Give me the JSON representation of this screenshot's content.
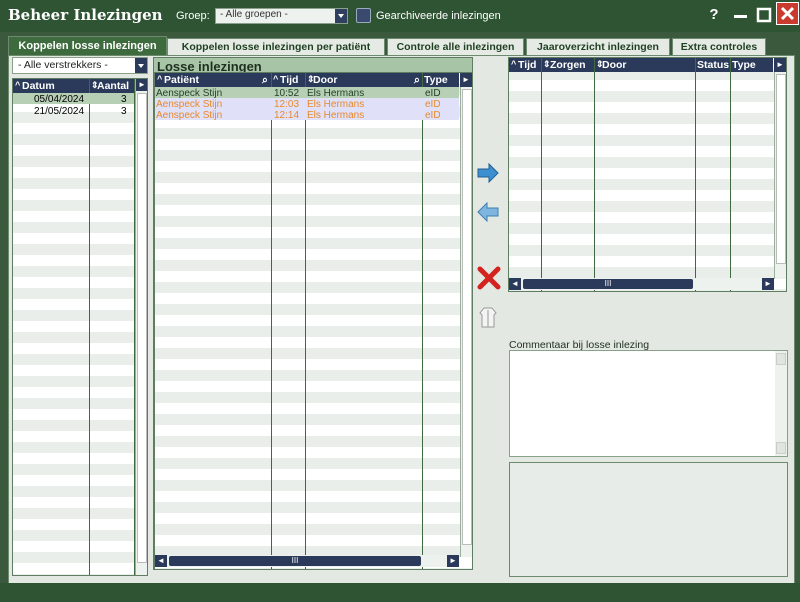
{
  "window": {
    "title": "Beheer Inlezingen",
    "group_label": "Groep:",
    "group_value": "- Alle groepen -",
    "archived_label": "Gearchiveerde inlezingen",
    "help": "?",
    "minimize": "—",
    "maximize": "☐",
    "close": "✕"
  },
  "tabs": [
    {
      "label": "Koppelen losse inlezingen"
    },
    {
      "label": "Koppelen losse inlezingen per patiënt"
    },
    {
      "label": "Controle alle inlezingen"
    },
    {
      "label": "Jaaroverzicht inlezingen"
    },
    {
      "label": "Extra controles"
    }
  ],
  "left": {
    "filter_value": "- Alle verstrekkers -",
    "headers": {
      "date": "Datum",
      "count": "Aantal"
    },
    "rows": [
      {
        "date": "05/04/2024",
        "count": "3"
      },
      {
        "date": "21/05/2024",
        "count": "3"
      }
    ]
  },
  "losse": {
    "title": "Losse inlezingen",
    "headers": {
      "patient": "Patiënt",
      "time": "Tijd",
      "by": "Door",
      "type": "Type"
    },
    "rows": [
      {
        "patient": "Aenspeck Stijn",
        "time": "10:52",
        "by": "Els Hermans",
        "type": "eID"
      },
      {
        "patient": "Aenspeck Stijn",
        "time": "12:03",
        "by": "Els Hermans",
        "type": "eID"
      },
      {
        "patient": "Aenspeck Stijn",
        "time": "12:14",
        "by": "Els Hermans",
        "type": "eID"
      }
    ],
    "hscroll_mark": "III"
  },
  "right": {
    "headers": {
      "time": "Tijd",
      "care": "Zorgen",
      "by": "Door",
      "status": "Status",
      "type": "Type"
    },
    "hscroll_mark": "III"
  },
  "comment": {
    "label": "Commentaar bij losse inlezing",
    "value": ""
  },
  "colors": {
    "title_bg": "#2f5433",
    "accent_green": "#3d6b3e",
    "header_navy": "#2b3a5a",
    "row_selected": "#b7d0b5",
    "row_highlight": "#e0e0f8",
    "orange_text": "#e8892b",
    "arrow_blue": "#3d8fd0",
    "delete_red": "#d2231f"
  }
}
